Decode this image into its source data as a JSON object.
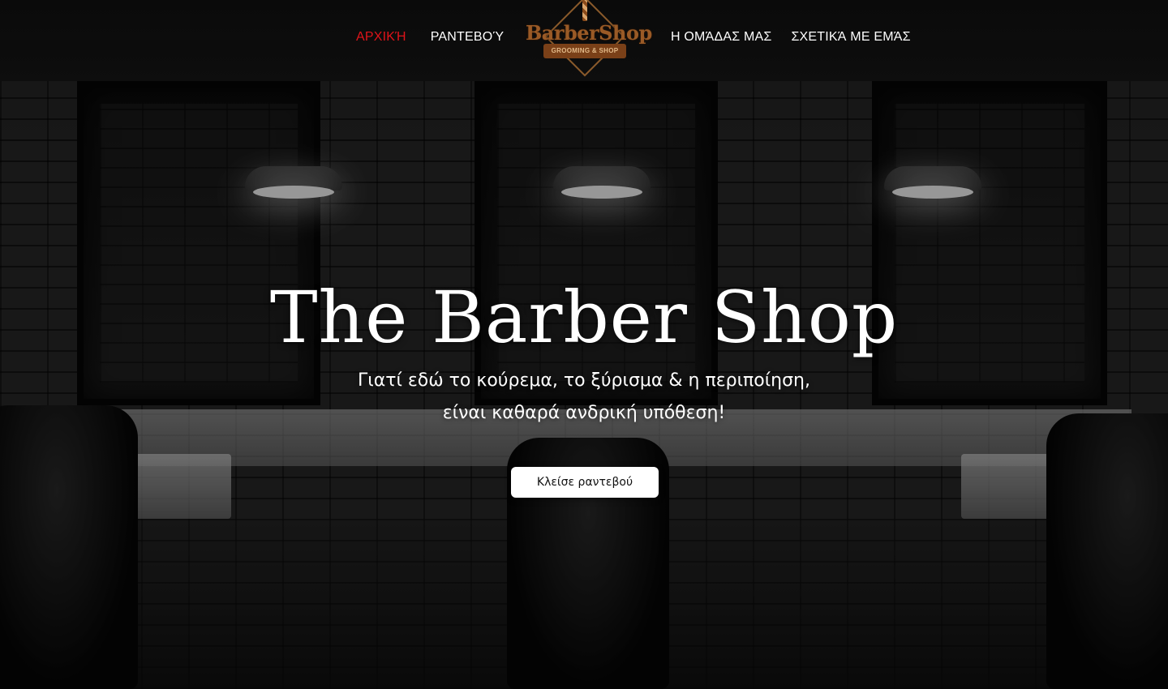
{
  "nav": {
    "left": [
      {
        "label": "ΑΡΧΙΚΉ",
        "active": true
      },
      {
        "label": "ΡΑΝΤΕΒΟΎ",
        "active": false
      }
    ],
    "right": [
      {
        "label": "Η ΟΜΆΔΑΣ ΜΑΣ",
        "active": false
      },
      {
        "label": "ΣΧΕΤΙΚΆ ΜΕ ΕΜΆΣ",
        "active": false
      }
    ]
  },
  "logo": {
    "word": "BarberShop",
    "tagline": "GROOMING & SHOP"
  },
  "hero": {
    "title": "The Barber Shop",
    "subtitle_line1": "Γιατί εδώ το κούρεμα, το ξύρισμα & η περιποίηση,",
    "subtitle_line2": "είναι καθαρά ανδρική υπόθεση!",
    "cta_label": "Κλείσε ραντεβού"
  },
  "colors": {
    "active_nav": "#e0141a",
    "logo_brown": "#9a5a26",
    "cta_bg": "#ffffff"
  }
}
